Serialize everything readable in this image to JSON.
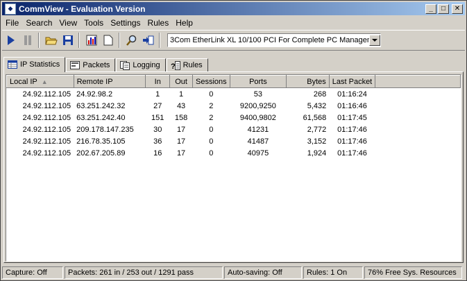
{
  "window": {
    "title": "CommView - Evaluation Version"
  },
  "menu": [
    "File",
    "Search",
    "View",
    "Tools",
    "Settings",
    "Rules",
    "Help"
  ],
  "toolbar": {
    "tools": [
      "start-capture-icon",
      "pause-capture-icon",
      "open-icon",
      "save-icon",
      "statistics-icon",
      "new-window-icon",
      "search-icon",
      "export-icon"
    ],
    "adapter": "3Com EtherLink XL 10/100 PCI For Complete PC Management"
  },
  "tabs": [
    {
      "label": "IP Statistics",
      "icon": "ip-statistics-icon",
      "active": true
    },
    {
      "label": "Packets",
      "icon": "packets-icon",
      "active": false
    },
    {
      "label": "Logging",
      "icon": "logging-icon",
      "active": false
    },
    {
      "label": "Rules",
      "icon": "rules-icon",
      "active": false
    }
  ],
  "columns": [
    "Local IP",
    "Remote IP",
    "In",
    "Out",
    "Sessions",
    "Ports",
    "Bytes",
    "Last Packet"
  ],
  "rows": [
    [
      "24.92.112.105",
      "24.92.98.2",
      "1",
      "1",
      "0",
      "53",
      "268",
      "01:16:24"
    ],
    [
      "24.92.112.105",
      "63.251.242.32",
      "27",
      "43",
      "2",
      "9200,9250",
      "5,432",
      "01:16:46"
    ],
    [
      "24.92.112.105",
      "63.251.242.40",
      "151",
      "158",
      "2",
      "9400,9802",
      "61,568",
      "01:17:45"
    ],
    [
      "24.92.112.105",
      "209.178.147.235",
      "30",
      "17",
      "0",
      "41231",
      "2,772",
      "01:17:46"
    ],
    [
      "24.92.112.105",
      "216.78.35.105",
      "36",
      "17",
      "0",
      "41487",
      "3,152",
      "01:17:46"
    ],
    [
      "24.92.112.105",
      "202.67.205.89",
      "16",
      "17",
      "0",
      "40975",
      "1,924",
      "01:17:46"
    ]
  ],
  "status": {
    "capture": "Capture: Off",
    "packets": "Packets: 261 in / 253 out / 1291 pass",
    "autosave": "Auto-saving: Off",
    "rules": "Rules: 1 On",
    "resources": "76% Free Sys. Resources"
  }
}
